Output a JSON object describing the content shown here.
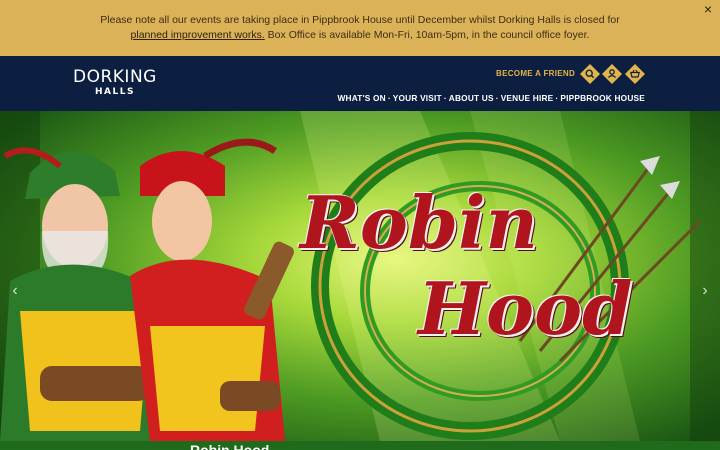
{
  "notice": {
    "line1": "Please note all our events are taking place in Pippbrook House until December whilst Dorking Halls is closed for",
    "link_text": "planned improvement works.",
    "line2_rest": " Box Office is available Mon-Fri, 10am-5pm, in the council office foyer.",
    "close_label": "×"
  },
  "header": {
    "logo_top": "DORKING",
    "logo_bottom": "HALLS",
    "become_friend": "BECOME A FRIEND",
    "icons": [
      "search-icon",
      "account-icon",
      "basket-icon"
    ],
    "nav": [
      "WHAT'S ON",
      "YOUR VISIT",
      "ABOUT US",
      "VENUE HIRE",
      "PIPPBROOK HOUSE"
    ],
    "nav_separator": "·"
  },
  "hero": {
    "title_word1": "Robin",
    "title_word2": "Hood",
    "prev_label": "‹",
    "next_label": "›"
  },
  "bottom_strip": {
    "text": "Robin Hood"
  },
  "colors": {
    "notice_bg": "#dcb258",
    "header_bg": "#0d1f40",
    "accent_gold": "#e2b54c",
    "title_red": "#b0141c"
  }
}
